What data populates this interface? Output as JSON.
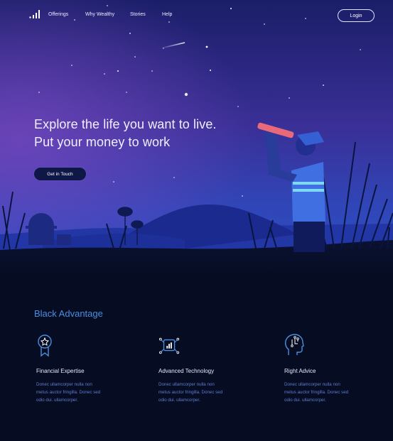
{
  "nav": {
    "items": [
      "Offerings",
      "Why Wealthy",
      "Stories",
      "Help"
    ],
    "login_label": "Login"
  },
  "hero": {
    "headline_line1": "Explore the life you want to live.",
    "headline_line2": "Put your money to work",
    "cta_label": "Get in Touch"
  },
  "advantage": {
    "title": "Black Advantage",
    "features": [
      {
        "icon": "award-ribbon-icon",
        "title": "Financial Expertise",
        "desc_lines": [
          "Donec ullamcorper nulla non",
          "metus auctor fringilla. Donec sed",
          "odio dui. ullamcorper."
        ]
      },
      {
        "icon": "chip-chart-icon",
        "title": "Advanced Technology",
        "desc_lines": [
          "Donec ullamcorper nulla non",
          "metus auctor fringilla. Donec sed",
          "odio dui. ullamcorper."
        ]
      },
      {
        "icon": "head-circuit-icon",
        "title": "Right Advice",
        "desc_lines": [
          "Donec ullamcorper nulla non",
          "metus auctor fringilla. Donec sed",
          "odio dui. ullamcorper."
        ]
      }
    ]
  },
  "colors": {
    "accent": "#4a8fe0",
    "sky_top": "#1b1f6b",
    "sky_mid": "#3b2f95",
    "background_dark": "#060c22"
  }
}
